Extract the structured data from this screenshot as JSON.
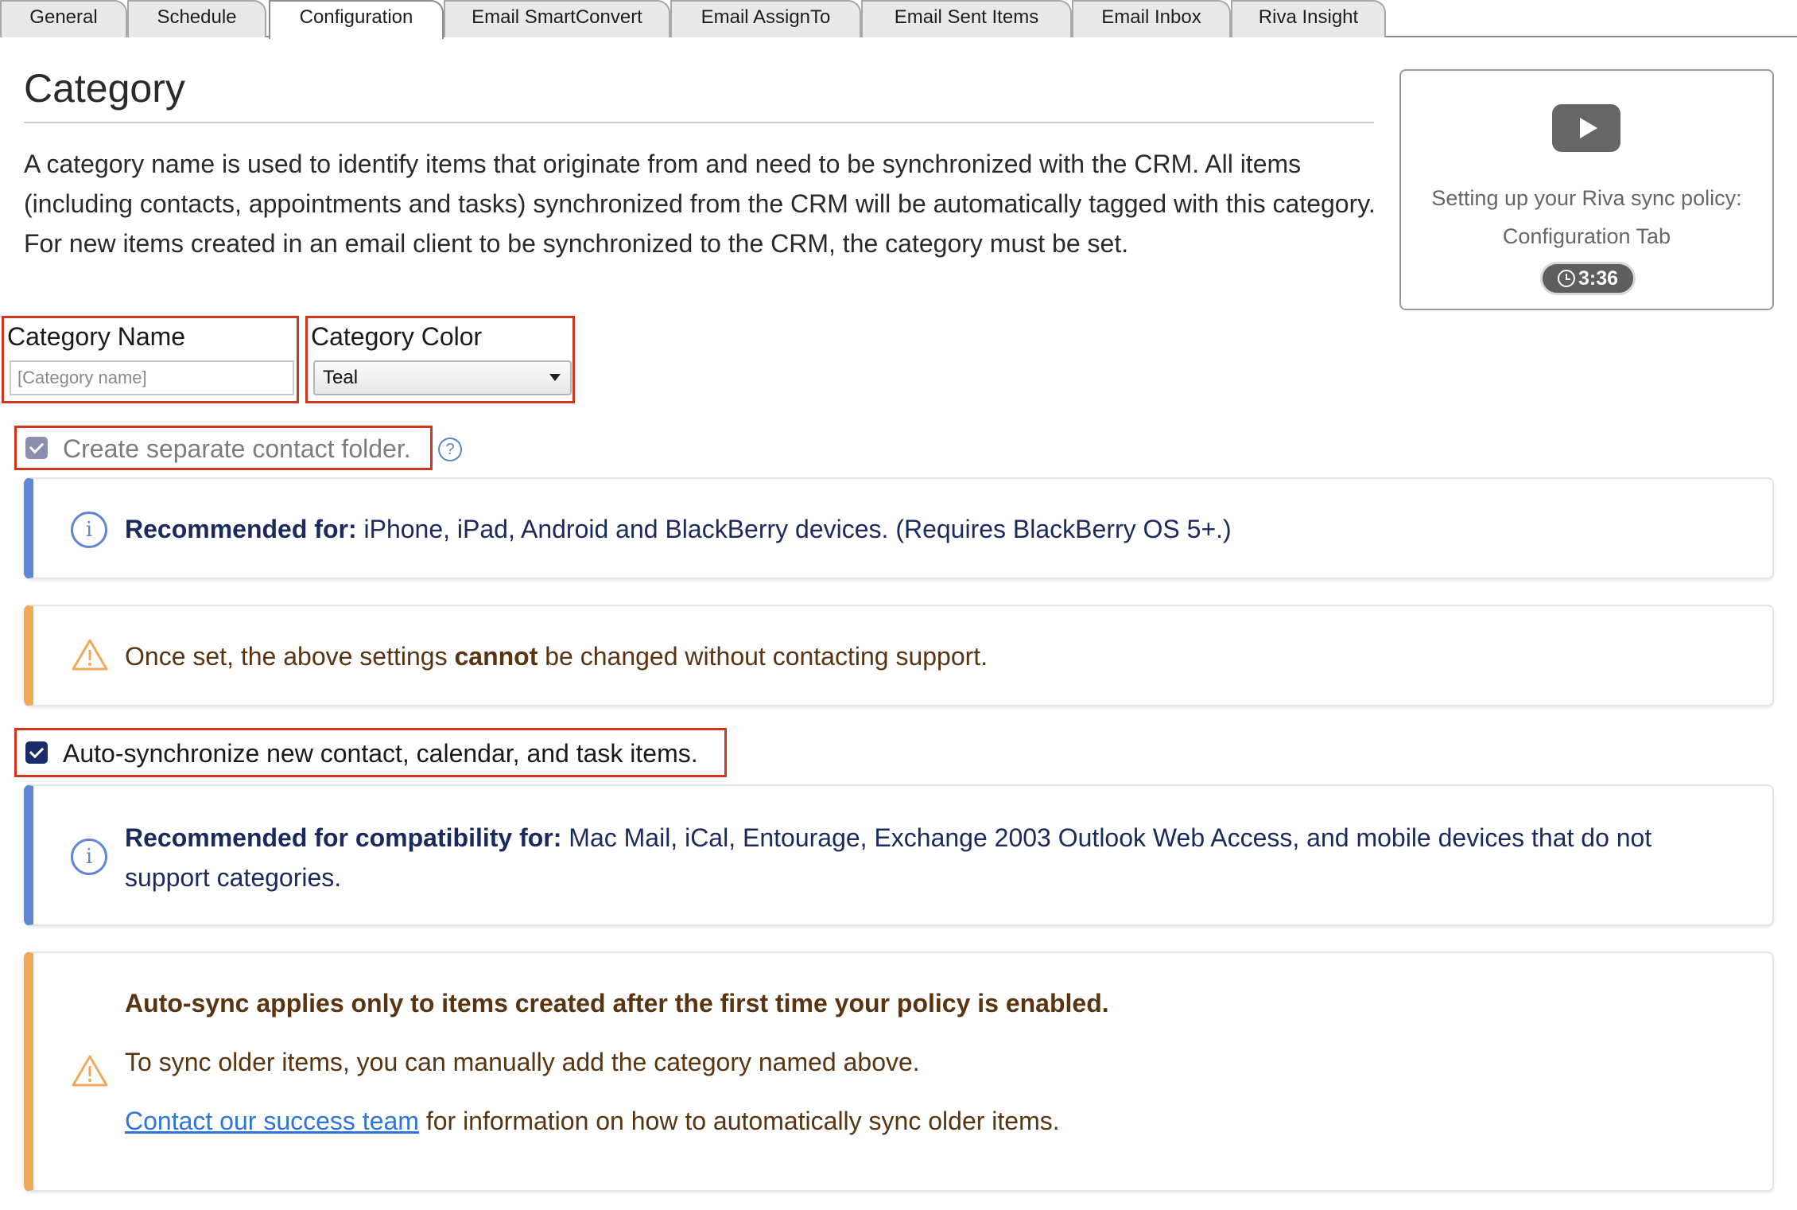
{
  "tabs": [
    {
      "label": "General",
      "active": false
    },
    {
      "label": "Schedule",
      "active": false
    },
    {
      "label": "Configuration",
      "active": true
    },
    {
      "label": "Email SmartConvert",
      "active": false
    },
    {
      "label": "Email AssignTo",
      "active": false
    },
    {
      "label": "Email Sent Items",
      "active": false
    },
    {
      "label": "Email Inbox",
      "active": false
    },
    {
      "label": "Riva Insight",
      "active": false
    }
  ],
  "page": {
    "title": "Category",
    "description": "A category name is used to identify items that originate from and need to be synchronized with the CRM. All items (including contacts, appointments and tasks) synchronized from the CRM will be automatically tagged with this category. For new items created in an email client to be synchronized to the CRM, the category must be set."
  },
  "video": {
    "title": "Setting up your Riva sync policy: Configuration Tab",
    "duration": "3:36"
  },
  "fields": {
    "category_name_label": "Category Name",
    "category_name_placeholder": "[Category name]",
    "category_name_value": "",
    "category_color_label": "Category Color",
    "category_color_value": "Teal"
  },
  "options": {
    "separate_folder_label": "Create separate contact folder.",
    "separate_folder_checked": true,
    "separate_folder_disabled": true,
    "help_glyph": "?",
    "auto_sync_label": "Auto-synchronize new contact, calendar, and task items.",
    "auto_sync_checked": true
  },
  "alerts": {
    "info1_bold": "Recommended for:",
    "info1_text": " iPhone, iPad, Android and BlackBerry devices. (Requires BlackBerry OS 5+.)",
    "warn1_pre": "Once set, the above settings ",
    "warn1_bold": "cannot",
    "warn1_post": " be changed without contacting support.",
    "info2_bold": "Recommended for compatibility for:",
    "info2_text": " Mac Mail, iCal, Entourage, Exchange 2003 Outlook Web Access, and mobile devices that do not support categories.",
    "warn2_heading": "Auto-sync applies only to items created after the first time your policy is enabled.",
    "warn2_line2": "To sync older items, you can manually add the category named above.",
    "warn2_link": "Contact our success team",
    "warn2_link_suffix": " for information on how to automatically sync older items."
  },
  "icons": {
    "info": "info-circle-icon",
    "warning": "warning-triangle-icon",
    "help": "question-circle-icon",
    "play": "play-icon",
    "clock": "clock-icon",
    "dropdown": "caret-down-icon"
  },
  "colors": {
    "highlight_border": "#d0361c",
    "info_accent": "#5f87d3",
    "warning_accent": "#f0a85c",
    "checkbox_enabled": "#1a2a6a",
    "link": "#2f76d6"
  }
}
